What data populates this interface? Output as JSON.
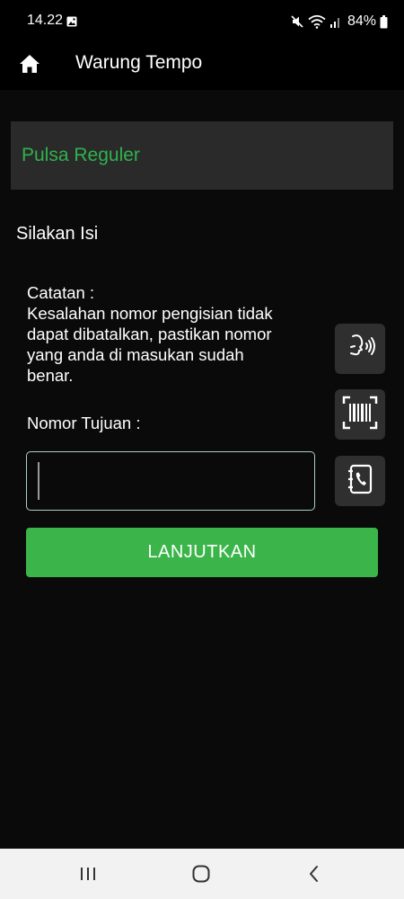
{
  "status_bar": {
    "time": "14.22",
    "battery": "84%",
    "icons": [
      "gallery-icon",
      "mute-icon",
      "wifi-icon",
      "signal-icon",
      "battery-icon"
    ]
  },
  "app_bar": {
    "title": "Warung Tempo",
    "icon": "home-icon"
  },
  "product": {
    "title": "Pulsa Reguler"
  },
  "form": {
    "heading": "Silakan Isi",
    "note_lines": [
      "Catatan :",
      "Kesalahan nomor pengisian tidak",
      "dapat dibatalkan, pastikan nomor",
      "yang anda di masukan sudah",
      "benar."
    ],
    "target_label": "Nomor Tujuan :",
    "phone_value": "",
    "submit_label": "LANJUTKAN"
  },
  "side_actions": [
    {
      "icon": "voice-input-icon"
    },
    {
      "icon": "barcode-scan-icon"
    },
    {
      "icon": "contact-book-icon"
    }
  ],
  "nav_bar": {
    "icons": [
      "recents-icon",
      "home-nav-icon",
      "back-icon"
    ]
  },
  "colors": {
    "background": "#0a0a0a",
    "accent_green": "#3bb54a",
    "title_green": "#2fb24c",
    "card": "#2a2a2a",
    "input_border": "#aacfc9"
  }
}
